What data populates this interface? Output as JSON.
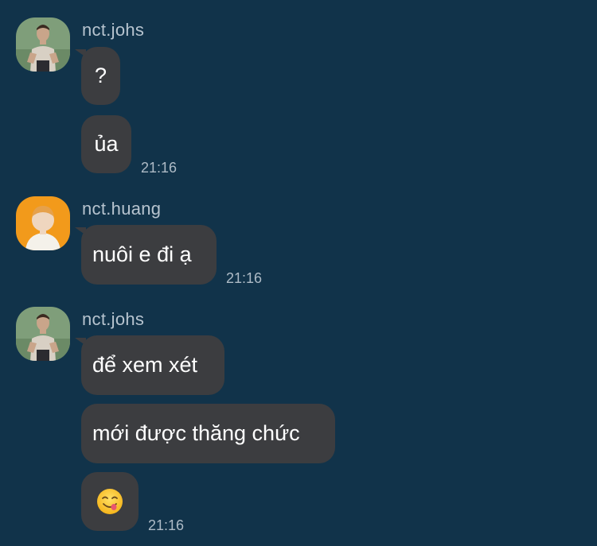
{
  "messages": [
    {
      "sender": "nct.johs",
      "avatar": "avatar-photo-man",
      "bubbles": [
        "?",
        "ủa"
      ],
      "time": "21:16"
    },
    {
      "sender": "nct.huang",
      "avatar": "avatar-photo-orange",
      "bubbles": [
        "nuôi e đi ạ"
      ],
      "time": "21:16"
    },
    {
      "sender": "nct.johs",
      "avatar": "avatar-photo-man",
      "bubbles": [
        "để xem xét",
        "mới được thăng chức"
      ],
      "emoji": "yum-face-emoji",
      "time": "21:16"
    }
  ],
  "colors": {
    "background": "#11334a",
    "bubble": "#3c3d40",
    "name_text": "#b7c4cf",
    "time_text": "#aebbc6"
  }
}
